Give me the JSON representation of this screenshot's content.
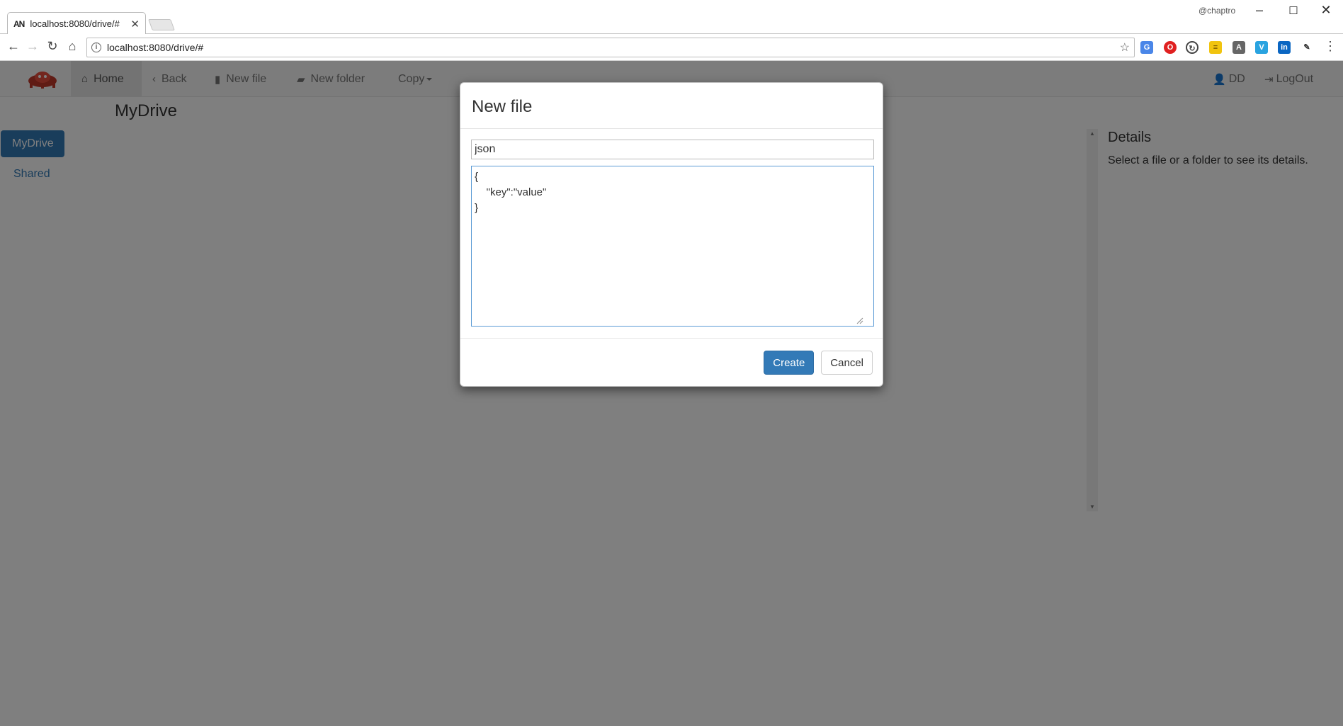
{
  "browser": {
    "tab_title": "localhost:8080/drive/#",
    "tab_favicon": "AN",
    "address": "localhost:8080/drive/#",
    "profile_name": "@chaptro"
  },
  "app": {
    "navbar": {
      "home": "Home",
      "back": "Back",
      "new_file": "New file",
      "new_folder": "New folder",
      "copy": "Copy",
      "user": "DD",
      "logout": "LogOut"
    },
    "page_title": "MyDrive",
    "sidebar": {
      "items": [
        {
          "label": "MyDrive",
          "active": true
        },
        {
          "label": "Shared",
          "active": false
        }
      ]
    },
    "details": {
      "title": "Details",
      "text": "Select a file or a folder to see its details."
    }
  },
  "modal": {
    "title": "New file",
    "name_value": "json",
    "content_value": "{\n    \"key\":\"value\"\n}",
    "create_label": "Create",
    "cancel_label": "Cancel"
  },
  "colors": {
    "primary": "#337ab7",
    "backdrop": "rgba(0,0,0,0.5)",
    "focus_border": "#5b9bd5"
  },
  "icons": {
    "home": "home-icon",
    "back": "chevron-left-icon",
    "new_file": "file-icon",
    "new_folder": "folder-open-icon",
    "user": "user-icon",
    "logout": "logout-icon"
  }
}
